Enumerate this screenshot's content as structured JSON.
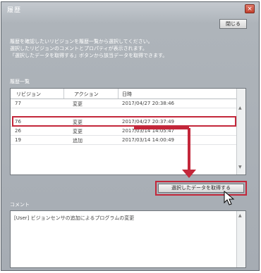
{
  "window": {
    "title": "履歴",
    "close_x": "×"
  },
  "close_button": "閉じる",
  "description": [
    "履歴を確認したいリビジョンを履歴一覧から選択してください。",
    "選択したリビジョンのコメントとプロパティが表示されます。",
    "「選択したデータを取得する」ボタンから該当データを取得できます。"
  ],
  "history": {
    "label": "履歴一覧",
    "columns": [
      "リビジョン",
      "アクション",
      "日時"
    ],
    "rows": [
      {
        "revision": "77",
        "action": "変更",
        "datetime": "2017/04/27 20:38:46"
      },
      {
        "revision": "76",
        "action": "変更",
        "datetime": "2017/04/27 20:37:49"
      },
      {
        "revision": "26",
        "action": "変更",
        "datetime": "2017/03/14 14:05:47"
      },
      {
        "revision": "19",
        "action": "追加",
        "datetime": "2017/03/14 14:00:49"
      }
    ]
  },
  "fetch_button": "選択したデータを取得する",
  "comment": {
    "label": "コメント",
    "text": "[User] ビジョンセンサの追加によるプログラムの変更"
  }
}
